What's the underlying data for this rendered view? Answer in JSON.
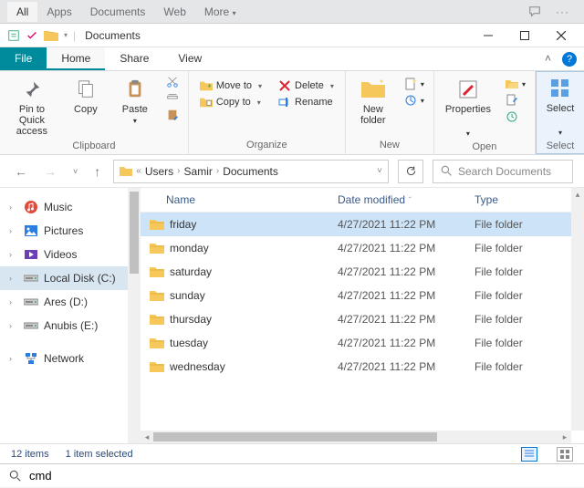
{
  "topbar": {
    "tabs": [
      "All",
      "Apps",
      "Documents",
      "Web",
      "More"
    ],
    "more_glyph": "▾"
  },
  "window": {
    "title": "Documents"
  },
  "ribbon_tabs": {
    "file": "File",
    "home": "Home",
    "share": "Share",
    "view": "View"
  },
  "ribbon": {
    "clipboard": {
      "label": "Clipboard",
      "pin": "Pin to Quick\naccess",
      "copy": "Copy",
      "paste": "Paste"
    },
    "organize": {
      "label": "Organize",
      "move_to": "Move to",
      "copy_to": "Copy to",
      "delete": "Delete",
      "rename": "Rename"
    },
    "new": {
      "label": "New",
      "new_folder": "New\nfolder"
    },
    "open": {
      "label": "Open",
      "properties": "Properties"
    },
    "select": {
      "label": "Select",
      "select": "Select"
    }
  },
  "breadcrumb": {
    "items": [
      "Users",
      "Samir",
      "Documents"
    ]
  },
  "search": {
    "placeholder": "Search Documents"
  },
  "sidebar": {
    "items": [
      {
        "label": "Music",
        "icon": "music",
        "color": "#e24a3b"
      },
      {
        "label": "Pictures",
        "icon": "pictures",
        "color": "#2a7de1"
      },
      {
        "label": "Videos",
        "icon": "videos",
        "color": "#6b3fb5"
      },
      {
        "label": "Local Disk (C:)",
        "icon": "disk",
        "color": "#888",
        "selected": true
      },
      {
        "label": "Ares (D:)",
        "icon": "disk",
        "color": "#888"
      },
      {
        "label": "Anubis (E:)",
        "icon": "disk",
        "color": "#888"
      },
      {
        "label": "Network",
        "icon": "network",
        "color": "#2a7de1"
      }
    ]
  },
  "columns": {
    "name": "Name",
    "date": "Date modified",
    "type": "Type"
  },
  "files": [
    {
      "name": "friday",
      "date": "4/27/2021 11:22 PM",
      "type": "File folder",
      "selected": true
    },
    {
      "name": "monday",
      "date": "4/27/2021 11:22 PM",
      "type": "File folder"
    },
    {
      "name": "saturday",
      "date": "4/27/2021 11:22 PM",
      "type": "File folder"
    },
    {
      "name": "sunday",
      "date": "4/27/2021 11:22 PM",
      "type": "File folder"
    },
    {
      "name": "thursday",
      "date": "4/27/2021 11:22 PM",
      "type": "File folder"
    },
    {
      "name": "tuesday",
      "date": "4/27/2021 11:22 PM",
      "type": "File folder"
    },
    {
      "name": "wednesday",
      "date": "4/27/2021 11:22 PM",
      "type": "File folder"
    }
  ],
  "status": {
    "count": "12 items",
    "selected": "1 item selected"
  },
  "cmd": {
    "value": "cmd"
  }
}
